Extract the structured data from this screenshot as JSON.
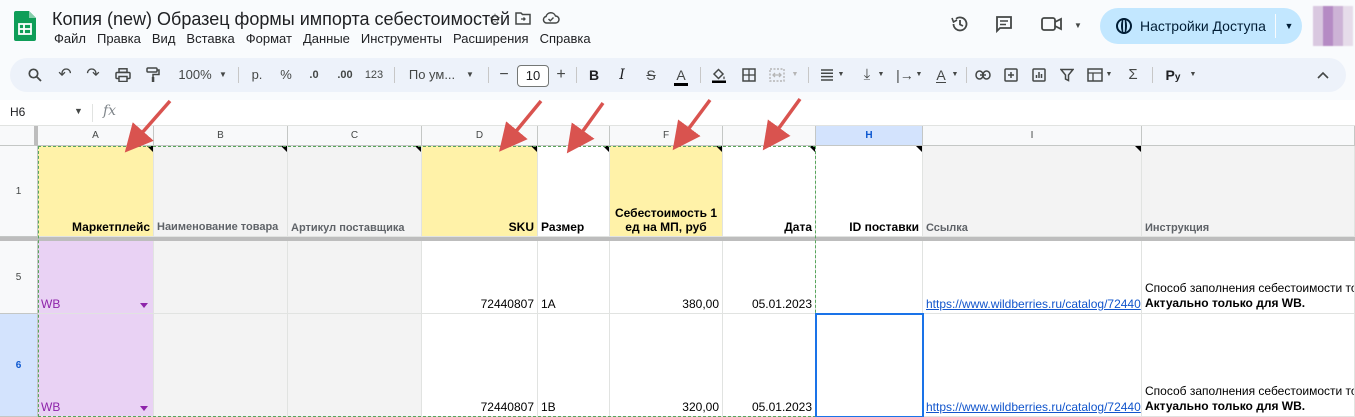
{
  "doc": {
    "title": "Копия (new) Образец формы импорта себестоимостей",
    "menu": [
      "Файл",
      "Правка",
      "Вид",
      "Вставка",
      "Формат",
      "Данные",
      "Инструменты",
      "Расширения",
      "Справка"
    ],
    "share_label": "Настройки Доступа"
  },
  "toolbar": {
    "zoom": "100%",
    "currency": "р.",
    "percent": "%",
    "dec_less": ".0",
    "dec_more": ".00",
    "number_format": "123",
    "font_name": "По ум...",
    "font_size": "10",
    "bold": "B",
    "italic": "I",
    "text_color": "A",
    "sigma": "Σ"
  },
  "formula_bar": {
    "cell_ref": "H6",
    "fx": "fx"
  },
  "columns": [
    "A",
    "B",
    "C",
    "D",
    "E",
    "F",
    "G",
    "H",
    "I",
    ""
  ],
  "rows": [
    {
      "num": "1"
    },
    {
      "num": "5"
    },
    {
      "num": "6"
    }
  ],
  "header_row": {
    "a": "Маркетплейс",
    "b": "Наименование товара",
    "c": "Артикул поставщика",
    "d": "SKU",
    "e": "Размер",
    "f": "Себестоимость 1 ед на МП, руб",
    "g": "Дата",
    "h": "ID поставки",
    "i": "Ссылка",
    "j": "Инструкция"
  },
  "data_rows": [
    {
      "a": "WB",
      "b": "",
      "c": "",
      "d": "72440807",
      "e": "1A",
      "f": "380,00",
      "g": "05.01.2023",
      "h": "",
      "i": "https://www.wildberries.ru/catalog/72440",
      "j1": "Способ заполнения себестоимости то",
      "j2": "Актуально только для WB."
    },
    {
      "a": "WB",
      "b": "",
      "c": "",
      "d": "72440807",
      "e": "1B",
      "f": "320,00",
      "g": "05.01.2023",
      "h": "",
      "i": "https://www.wildberries.ru/catalog/72440",
      "j1": "Способ заполнения себестоимости то",
      "j2": "Актуально только для WB."
    }
  ],
  "colors": {
    "yellow_header": "#fff2a8",
    "gray_header": "#f3f3f3",
    "purple_cell": "#e9d2f4",
    "arrow": "#d9534f",
    "selection": "#1a73e8"
  }
}
